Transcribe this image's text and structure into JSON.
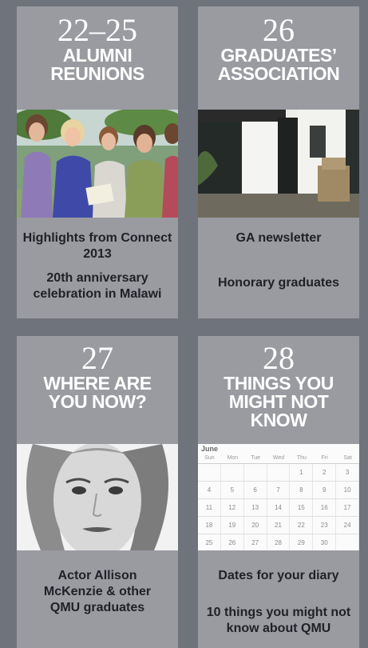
{
  "cards": [
    {
      "number": "22–25",
      "title_lines": [
        "ALUMNI",
        "REUNIONS"
      ],
      "links": [
        "Highlights from Connect 2013",
        "20th anniversary celebration in Malawi"
      ]
    },
    {
      "number": "26",
      "title_lines": [
        "GRADUATES’",
        "ASSOCIATION"
      ],
      "links": [
        "GA newsletter",
        "Honorary graduates"
      ]
    },
    {
      "number": "27",
      "title_lines": [
        "WHERE ARE",
        "YOU NOW?"
      ],
      "links": [
        "Actor Allison McKenzie & other QMU graduates"
      ]
    },
    {
      "number": "28",
      "title_lines": [
        "THINGS YOU",
        "MIGHT NOT",
        "KNOW"
      ],
      "links": [
        "Dates for your diary",
        "10 things you might not know about QMU"
      ]
    }
  ],
  "calendar": {
    "month": "June",
    "weekdays": [
      "Sun",
      "Mon",
      "Tue",
      "Wed",
      "Thu",
      "Fri",
      "Sat"
    ],
    "rows": [
      [
        "",
        "",
        "",
        "",
        "1",
        "2",
        "3"
      ],
      [
        "4",
        "5",
        "6",
        "7",
        "8",
        "9",
        "10"
      ],
      [
        "11",
        "12",
        "13",
        "14",
        "15",
        "16",
        "17"
      ],
      [
        "18",
        "19",
        "20",
        "21",
        "22",
        "23",
        "24"
      ],
      [
        "25",
        "26",
        "27",
        "28",
        "29",
        "30",
        ""
      ]
    ]
  }
}
